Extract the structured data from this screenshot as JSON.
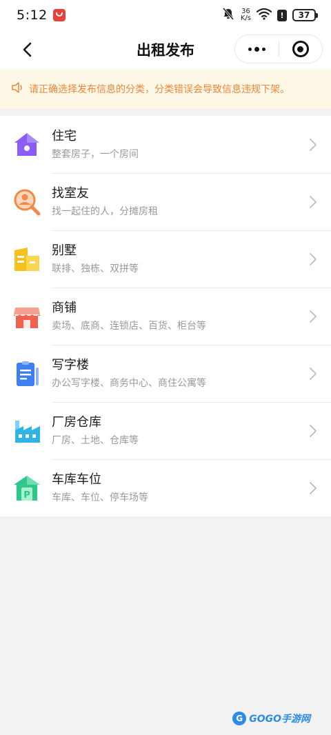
{
  "status_bar": {
    "time": "5:12",
    "net_speed_value": "36",
    "net_speed_unit": "K/s",
    "battery": "37",
    "icons": [
      "app-badge-icon",
      "mute-bell-icon",
      "wifi-icon",
      "alert-icon",
      "battery-icon"
    ]
  },
  "navbar": {
    "title": "出租发布",
    "icons": [
      "back-icon",
      "more-icon",
      "target-icon"
    ]
  },
  "notice": {
    "icon": "speaker-icon",
    "text": "请正确选择发布信息的分类，分类错误会导致信息违规下架。"
  },
  "categories": [
    {
      "title": "住宅",
      "subtitle": "整套房子，一个房间",
      "icon": "house-icon",
      "color": "#8b5cf6"
    },
    {
      "title": "找室友",
      "subtitle": "找一起住的人，分摊房租",
      "icon": "search-person-icon",
      "color": "#f08a45"
    },
    {
      "title": "别墅",
      "subtitle": "联排、独栋、双拼等",
      "icon": "villa-icon",
      "color": "#f5c21b"
    },
    {
      "title": "商铺",
      "subtitle": "卖场、底商、连锁店、百货、柜台等",
      "icon": "shop-icon",
      "color": "#f0614e"
    },
    {
      "title": "写字楼",
      "subtitle": "办公写字楼、商务中心、商住公寓等",
      "icon": "office-icon",
      "color": "#3f7ff0"
    },
    {
      "title": "厂房仓库",
      "subtitle": "厂房、土地、仓库等",
      "icon": "factory-icon",
      "color": "#2fb4e8"
    },
    {
      "title": "车库车位",
      "subtitle": "车库、车位、停车场等",
      "icon": "parking-icon",
      "color": "#2ec78a"
    }
  ],
  "watermark": {
    "brand": "GOGO手游网",
    "letter": "G"
  }
}
